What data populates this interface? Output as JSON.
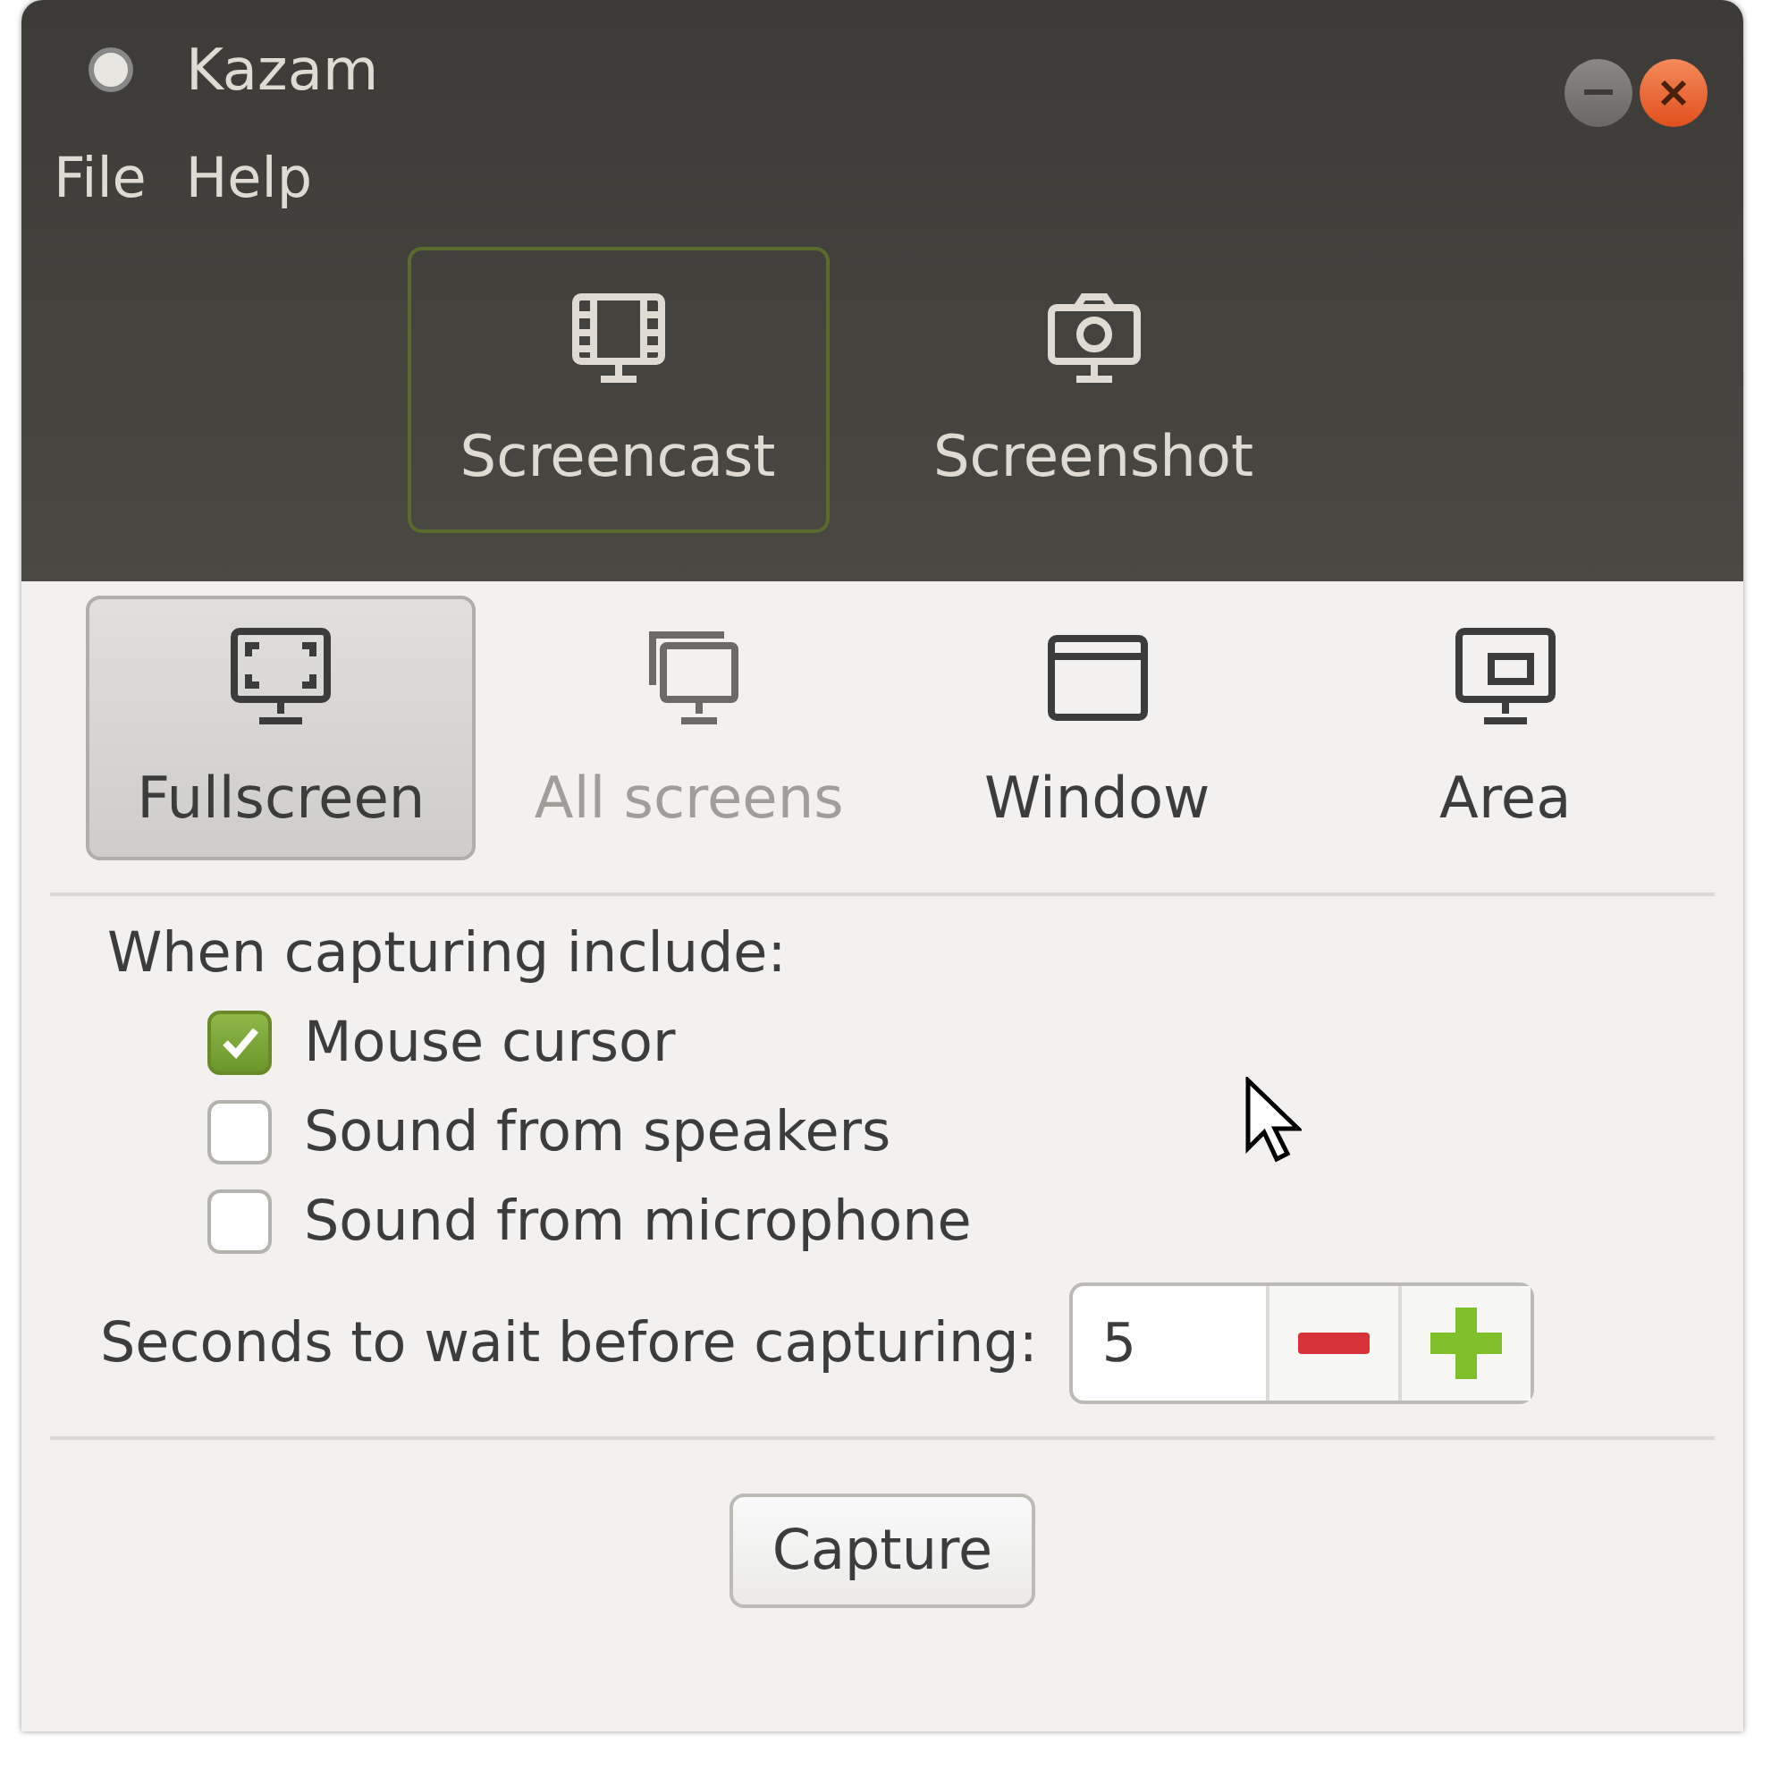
{
  "window": {
    "title": "Kazam"
  },
  "menu": [
    "File",
    "Help"
  ],
  "modes": [
    {
      "label": "Screencast",
      "selected": true
    },
    {
      "label": "Screenshot",
      "selected": false
    }
  ],
  "sources": [
    {
      "label": "Fullscreen",
      "selected": true,
      "disabled": false
    },
    {
      "label": "All screens",
      "selected": false,
      "disabled": true
    },
    {
      "label": "Window",
      "selected": false,
      "disabled": false
    },
    {
      "label": "Area",
      "selected": false,
      "disabled": false
    }
  ],
  "include_label": "When capturing include:",
  "options": [
    {
      "label": "Mouse cursor",
      "checked": true
    },
    {
      "label": "Sound from speakers",
      "checked": false
    },
    {
      "label": "Sound from microphone",
      "checked": false
    }
  ],
  "delay": {
    "label": "Seconds to wait before capturing:",
    "value": "5"
  },
  "capture_button": "Capture"
}
